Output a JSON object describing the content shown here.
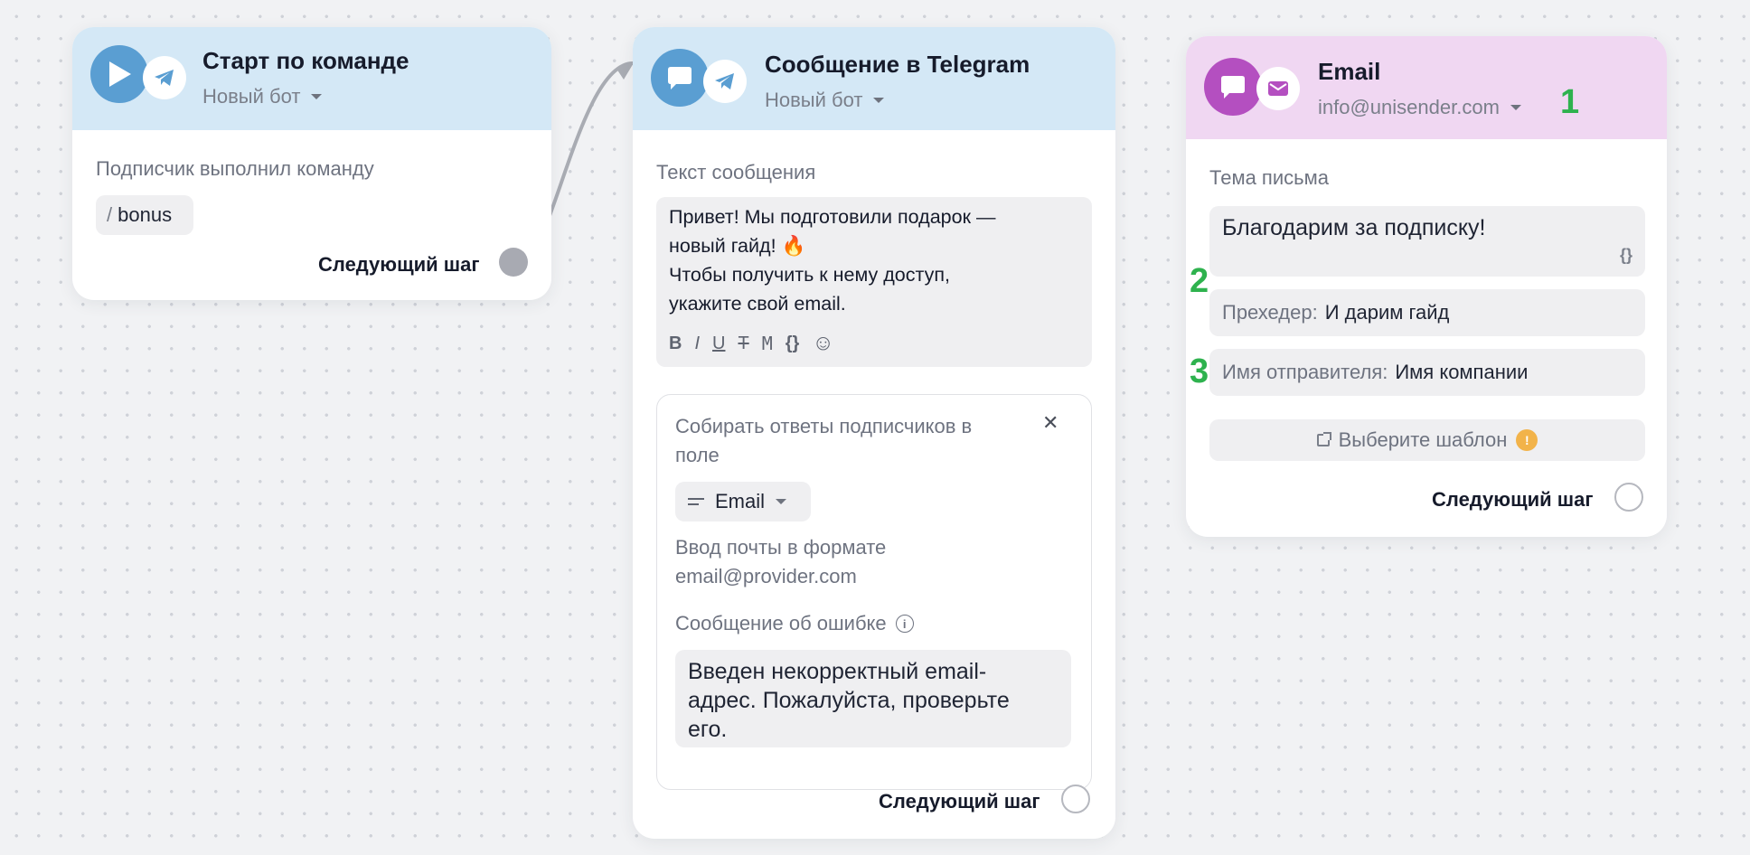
{
  "start_card": {
    "title": "Старт по команде",
    "bot": "Новый бот",
    "condition_label": "Подписчик выполнил команду",
    "command_slash": "/",
    "command": "bonus",
    "next_step": "Следующий шаг"
  },
  "telegram_card": {
    "title": "Сообщение в Telegram",
    "bot": "Новый бот",
    "text_label": "Текст сообщения",
    "message_lines": [
      "Привет! Мы подготовили подарок  —",
      "новый гайд! 🔥",
      "Чтобы получить к нему доступ,",
      "укажите свой email."
    ],
    "toolbar": [
      "B",
      "I",
      "U",
      "T",
      "M",
      "{}",
      "☺"
    ],
    "collect_label_1": "Собирать ответы подписчиков в",
    "collect_label_2": "поле",
    "field_name": "Email",
    "format_hint_1": "Ввод почты в формате",
    "format_hint_2": "email@provider.com",
    "error_label": "Сообщение об ошибке",
    "error_lines": [
      "Введен некорректный email-",
      "адрес. Пожалуйста, проверьте",
      "его."
    ],
    "next_step": "Следующий шаг"
  },
  "email_card": {
    "title": "Email",
    "sender_address": "info@unisender.com",
    "subject_label": "Тема письма",
    "subject_value": "Благодарим за подписку!",
    "variables_glyph": "{}",
    "preheader_label": "Прехедер:",
    "preheader_value": "И дарим гайд",
    "sender_name_label": "Имя отправителя:",
    "sender_name_value": "Имя компании",
    "template_button": "Выберите шаблон",
    "next_step": "Следующий шаг"
  },
  "badges": [
    "1",
    "2",
    "3"
  ],
  "colors": {
    "header_blue": "#d4e8f6",
    "header_pink": "#f0d7f2",
    "icon_blue": "#5a9ed2",
    "icon_purple": "#b44fc0",
    "badge_green": "#2eb24e",
    "warning": "#f2b34a"
  }
}
